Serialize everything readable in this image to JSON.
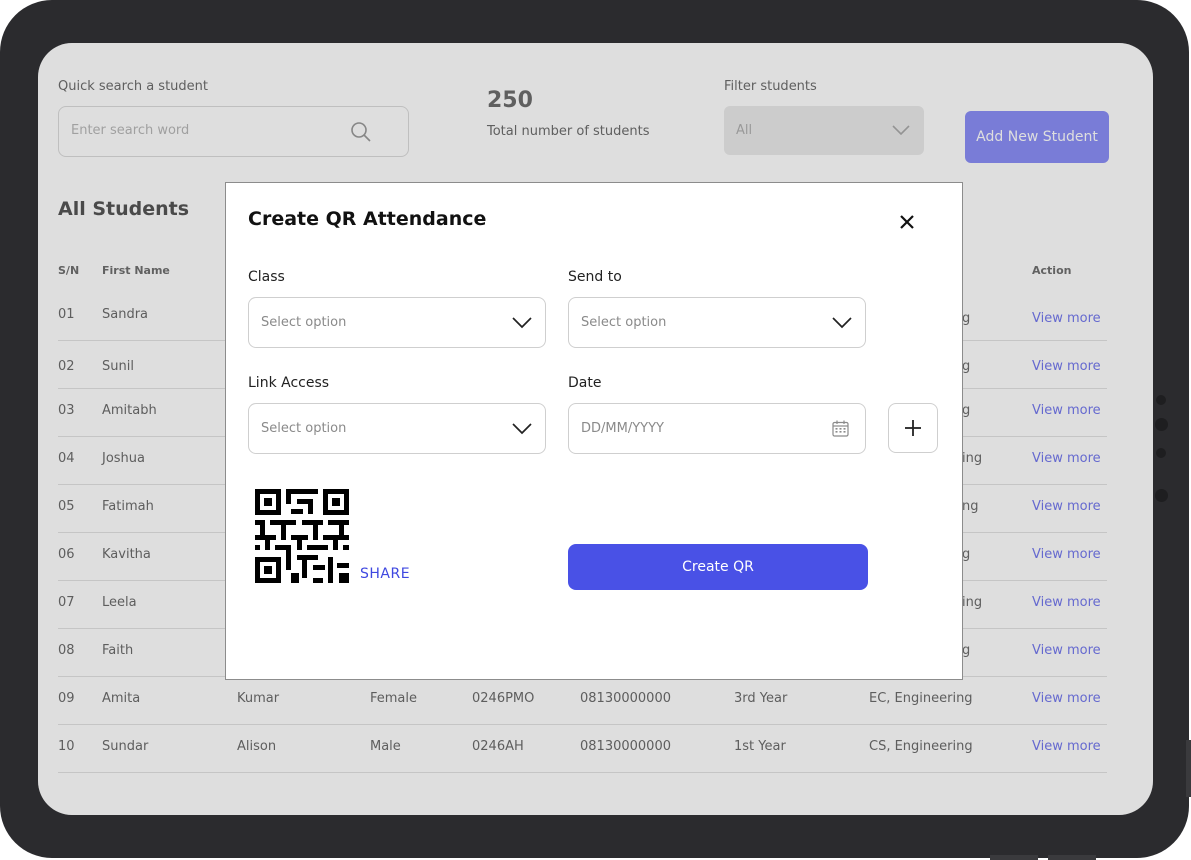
{
  "background": {
    "search": {
      "label": "Quick search a student",
      "placeholder": "Enter search word",
      "icon": "search-icon"
    },
    "stats": {
      "count": "250",
      "label": "Total number of students"
    },
    "filter": {
      "label": "Filter students",
      "value": "All"
    },
    "add_button": "Add New Student",
    "section_title": "All Students",
    "table": {
      "headers": {
        "sn": "S/N",
        "first_name": "First Name",
        "action": "Action"
      },
      "rows": [
        {
          "sn": "01",
          "first": "Sandra",
          "tail": "g",
          "action": "View more"
        },
        {
          "sn": "02",
          "first": "Sunil",
          "tail": "g",
          "action": "View more"
        },
        {
          "sn": "03",
          "first": "Amitabh",
          "tail": "g",
          "action": "View more"
        },
        {
          "sn": "04",
          "first": "Joshua",
          "tail": "ing",
          "action": "View more"
        },
        {
          "sn": "05",
          "first": "Fatimah",
          "tail": "ng",
          "action": "View more"
        },
        {
          "sn": "06",
          "first": "Kavitha",
          "tail": "g",
          "action": "View more"
        },
        {
          "sn": "07",
          "first": "Leela",
          "tail": "ing",
          "action": "View more"
        },
        {
          "sn": "08",
          "first": "Faith",
          "tail": "g",
          "action": "View more"
        },
        {
          "sn": "09",
          "first": "Amita",
          "last": "Kumar",
          "gender": "Female",
          "id": "0246PMO",
          "phone": "08130000000",
          "year": "3rd Year",
          "dept": "EC, Engineering",
          "action": "View more"
        },
        {
          "sn": "10",
          "first": "Sundar",
          "last": "Alison",
          "gender": "Male",
          "id": "0246AH",
          "phone": "08130000000",
          "year": "1st Year",
          "dept": "CS, Engineering",
          "action": "View more"
        }
      ]
    }
  },
  "modal": {
    "title": "Create QR Attendance",
    "class": {
      "label": "Class",
      "placeholder": "Select option"
    },
    "send_to": {
      "label": "Send to",
      "placeholder": "Select option"
    },
    "link_access": {
      "label": "Link Access",
      "placeholder": "Select option"
    },
    "date": {
      "label": "Date",
      "placeholder": "DD/MM/YYYY",
      "icon": "calendar-icon"
    },
    "add_icon": "plus-icon",
    "share_label": "SHARE",
    "create_button": "Create QR"
  },
  "colors": {
    "primary": "#4951e6",
    "primary_light": "#8b8ff7",
    "link": "#7479ee",
    "device_frame": "#2b2b2e"
  }
}
